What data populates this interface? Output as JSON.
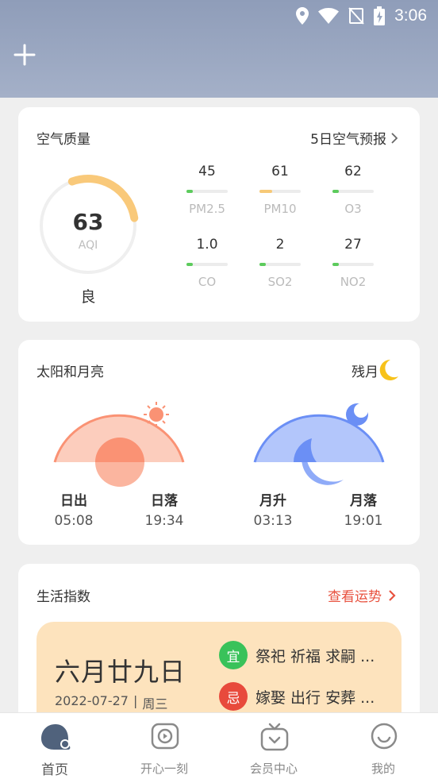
{
  "status_bar": {
    "time": "3:06"
  },
  "header": {
    "add_icon": "plus-icon"
  },
  "air_quality": {
    "title": "空气质量",
    "forecast_link": "5日空气预报",
    "aqi_value": "63",
    "aqi_unit": "AQI",
    "aqi_level": "良",
    "aqi_fraction": 0.28,
    "pollutants": [
      {
        "value": "45",
        "name": "PM2.5",
        "level": 0.15,
        "color": "#5ccb5c"
      },
      {
        "value": "61",
        "name": "PM10",
        "level": 0.3,
        "color": "#f7c977"
      },
      {
        "value": "62",
        "name": "O3",
        "level": 0.15,
        "color": "#5ccb5c"
      },
      {
        "value": "1.0",
        "name": "CO",
        "level": 0.15,
        "color": "#5ccb5c"
      },
      {
        "value": "2",
        "name": "SO2",
        "level": 0.15,
        "color": "#5ccb5c"
      },
      {
        "value": "27",
        "name": "NO2",
        "level": 0.15,
        "color": "#5ccb5c"
      }
    ]
  },
  "sun_moon": {
    "title": "太阳和月亮",
    "moon_phase": "残月",
    "sunrise_label": "日出",
    "sunrise_time": "05:08",
    "sunset_label": "日落",
    "sunset_time": "19:34",
    "moonrise_label": "月升",
    "moonrise_time": "03:13",
    "moonset_label": "月落",
    "moonset_time": "19:01"
  },
  "life_index": {
    "title": "生活指数",
    "fortune_link": "查看运势",
    "lunar_date": "六月廿九日",
    "gregorian_date": "2022-07-27",
    "separator": "|",
    "weekday": "周三",
    "suitable_tag": "宜",
    "suitable_items": "祭祀 祈福 求嗣 ...",
    "avoid_tag": "忌",
    "avoid_items": "嫁娶 出行 安葬 ..."
  },
  "bottom_nav": {
    "items": [
      {
        "label": "首页",
        "icon": "home-icon",
        "active": true
      },
      {
        "label": "开心一刻",
        "icon": "video-icon",
        "active": false
      },
      {
        "label": "会员中心",
        "icon": "tv-icon",
        "active": false
      },
      {
        "label": "我的",
        "icon": "smile-icon",
        "active": false
      }
    ]
  },
  "colors": {
    "header": "#98a6c0",
    "aqi_arc": "#f9c97a",
    "sun": "#fa9274",
    "moon": "#6b8ff5",
    "fortune": "#e8523f",
    "suitable": "#39c25a",
    "avoid": "#e84a3c"
  }
}
